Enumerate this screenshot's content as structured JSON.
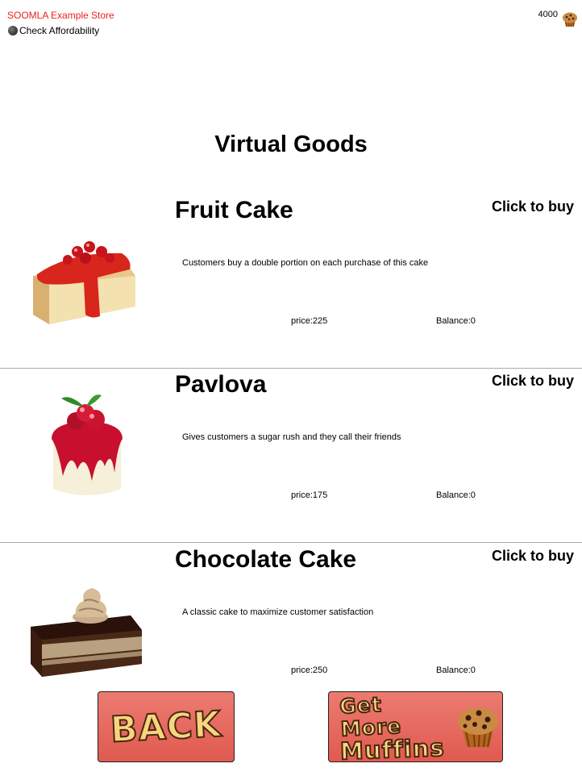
{
  "header": {
    "store_title": "SOOMLA Example Store",
    "check_affordability": "Check Affordability",
    "balance": "4000",
    "currency_icon": "muffin-icon"
  },
  "section_title": "Virtual Goods",
  "goods": [
    {
      "name": "Fruit Cake",
      "buy_label": "Click to buy",
      "description": "Customers buy a double portion on each purchase of this cake",
      "price": "price:225",
      "balance": "Balance:0",
      "icon": "fruit-cake-icon"
    },
    {
      "name": "Pavlova",
      "buy_label": "Click to buy",
      "description": "Gives customers a sugar rush and they call their friends",
      "price": "price:175",
      "balance": "Balance:0",
      "icon": "pavlova-icon"
    },
    {
      "name": "Chocolate Cake",
      "buy_label": "Click to buy",
      "description": "A classic cake to maximize customer satisfaction",
      "price": "price:250",
      "balance": "Balance:0",
      "icon": "chocolate-cake-icon"
    }
  ],
  "buttons": {
    "back_label": "BACK",
    "more_line1": "Get More",
    "more_line2": "Muffins"
  },
  "colors": {
    "title_red": "#e8231b",
    "button_red": "#e05a50"
  }
}
